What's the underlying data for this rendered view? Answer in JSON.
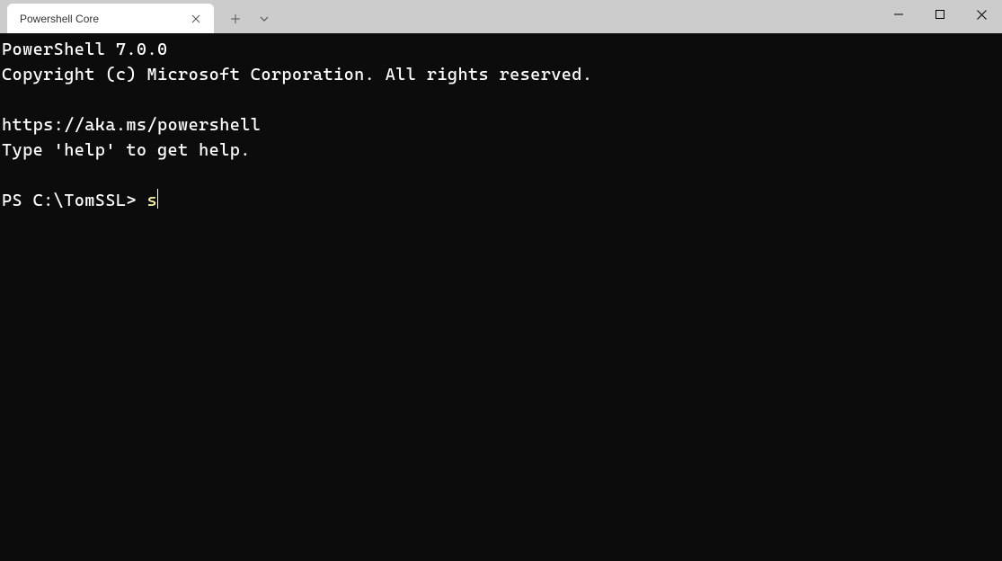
{
  "titlebar": {
    "tab": {
      "title": "Powershell Core"
    }
  },
  "terminal": {
    "lines": {
      "version": "PowerShell 7.0.0",
      "copyright": "Copyright (c) Microsoft Corporation. All rights reserved.",
      "blank1": "",
      "url": "https://aka.ms/powershell",
      "help": "Type 'help' to get help.",
      "blank2": ""
    },
    "prompt": {
      "prefix": "PS C:\\TomSSL> ",
      "input": "s"
    }
  }
}
